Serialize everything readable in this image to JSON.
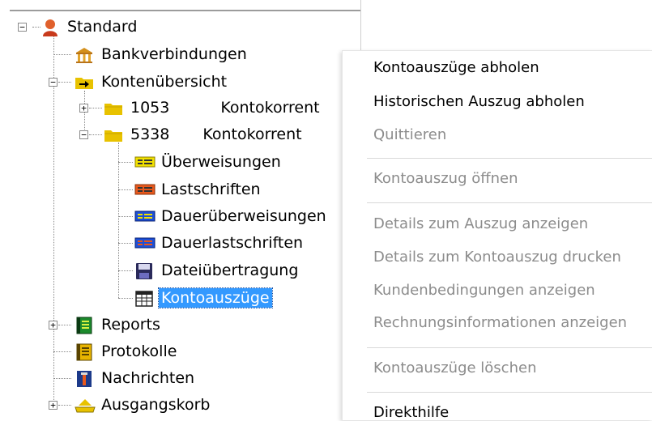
{
  "tree": {
    "root": {
      "label": "Standard"
    },
    "items": {
      "bank": "Bankverbindungen",
      "accounts_overview": "Kontenübersicht",
      "account_1053": {
        "number": "1053",
        "type": "Kontokorrent"
      },
      "account_5338": {
        "number": "5338",
        "type": "Kontokorrent"
      },
      "transfers": "Überweisungen",
      "direct_debits": "Lastschriften",
      "standing_orders": "Dauerüberweisungen",
      "recurring_debits": "Dauerlastschriften",
      "file_transfer": "Dateiübertragung",
      "statements": "Kontoauszüge",
      "reports": "Reports",
      "logs": "Protokolle",
      "messages": "Nachrichten",
      "outbox": "Ausgangskorb"
    },
    "expanders": {
      "minus": "−",
      "plus": "+"
    }
  },
  "context_menu": {
    "fetch_statements": "Kontoauszüge abholen",
    "fetch_historic": "Historischen Auszug abholen",
    "acknowledge": "Quittieren",
    "open_statement": "Kontoauszug öffnen",
    "show_statement_details": "Details zum Auszug anzeigen",
    "print_statement_details": "Details zum Kontoauszug drucken",
    "show_customer_terms": "Kundenbedingungen anzeigen",
    "show_invoice_info": "Rechnungsinformationen anzeigen",
    "delete_statements": "Kontoauszüge löschen",
    "direct_help": "Direkthilfe"
  },
  "colors": {
    "selection": "#3399ff",
    "disabled_text": "#8c8c8c",
    "folder": "#e8c200"
  }
}
